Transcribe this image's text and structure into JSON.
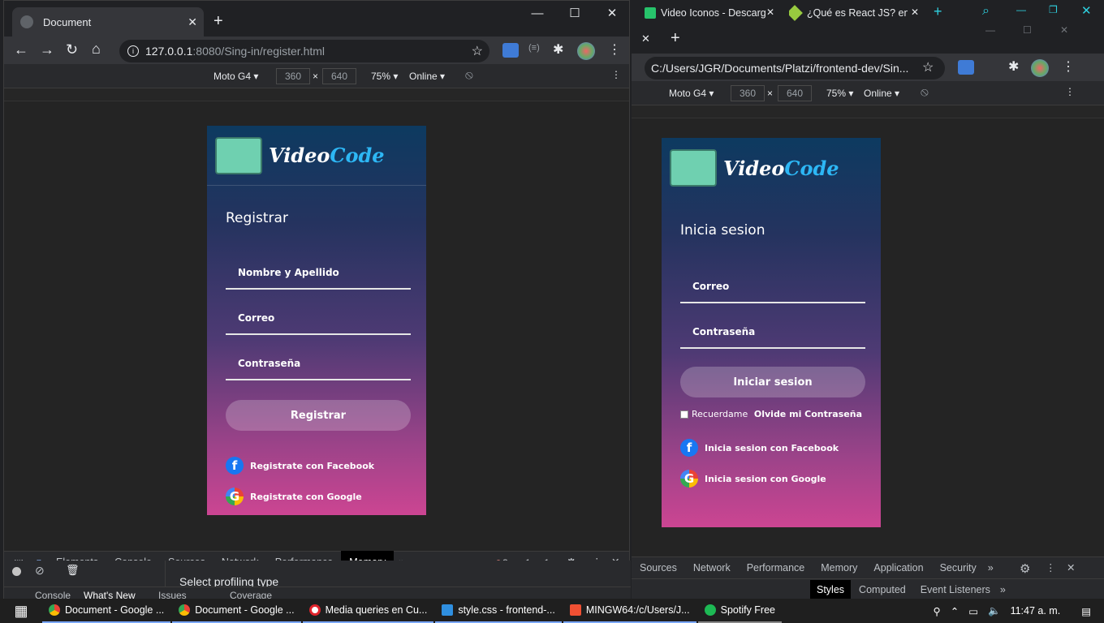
{
  "left_window": {
    "tab_title": "Document",
    "url_host": "127.0.0.1",
    "url_rest": ":8080/Sing-in/register.html",
    "device": "Moto G4",
    "width": "360",
    "height": "640",
    "zoom": "75%",
    "network": "Online",
    "page": {
      "brand_a": "Video",
      "brand_b": "Code",
      "title": "Registrar",
      "fields": [
        "Nombre y Apellido",
        "Correo",
        "Contraseña"
      ],
      "button": "Registrar",
      "social": [
        "Registrate con Facebook",
        "Registrate con Google"
      ]
    },
    "devtools": {
      "tabs": [
        "Elements",
        "Console",
        "Sources",
        "Network",
        "Performance",
        "Memory"
      ],
      "active": "Memory",
      "errors": "3",
      "warnings": "1",
      "info": "1",
      "panel_text": "Select profiling type",
      "drawer_tabs": [
        "Console",
        "What's New",
        "Issues",
        "Coverage"
      ]
    }
  },
  "right_window": {
    "tabs": [
      "Video Iconos - Descarg",
      "¿Qué es React JS? en C"
    ],
    "url": "C:/Users/JGR/Documents/Platzi/frontend-dev/Sin...",
    "device": "Moto G4",
    "width": "360",
    "height": "640",
    "zoom": "75%",
    "network": "Online",
    "page": {
      "brand_a": "Video",
      "brand_b": "Code",
      "title": "Inicia sesion",
      "fields": [
        "Correo",
        "Contraseña"
      ],
      "button": "Iniciar sesion",
      "remember": "Recuerdame",
      "forgot": "Olvide mi Contraseña",
      "social": [
        "Inicia sesion con Facebook",
        "Inicia sesion con Google"
      ]
    },
    "devtools": {
      "tabs": [
        "Sources",
        "Network",
        "Performance",
        "Memory",
        "Application",
        "Security"
      ],
      "sub_tabs": [
        "Styles",
        "Computed",
        "Event Listeners"
      ],
      "active_sub": "Styles"
    }
  },
  "taskbar": {
    "items": [
      "Document - Google ...",
      "Document - Google ...",
      "Media queries en Cu...",
      "style.css - frontend-...",
      "MINGW64:/c/Users/J...",
      "Spotify Free"
    ],
    "time": "11:47 a. m."
  },
  "colors": {
    "accent": "#2db7f5",
    "brand_blue": "#2db7f5",
    "facebook": "#1877f2"
  }
}
